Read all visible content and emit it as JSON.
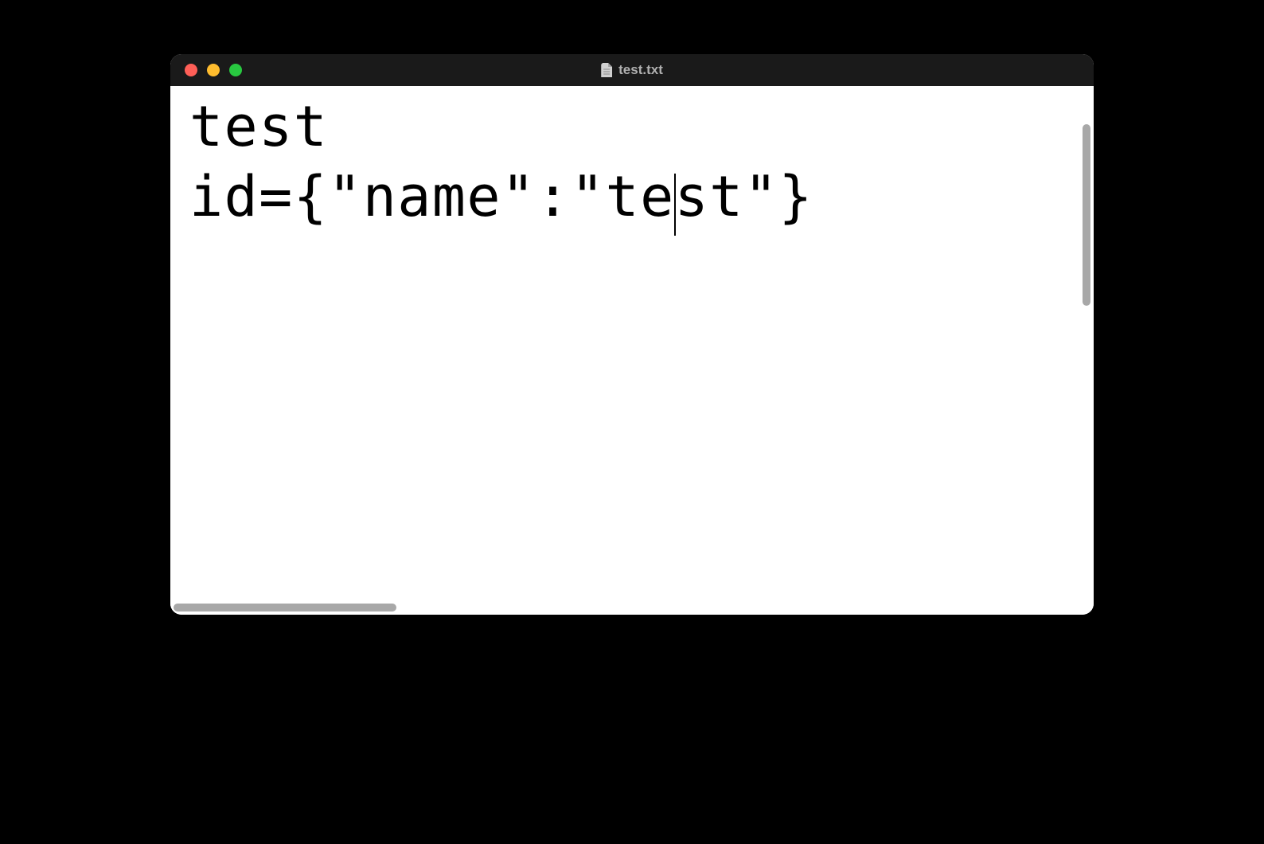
{
  "window": {
    "title": "test.txt"
  },
  "editor": {
    "lines": [
      "test",
      "id={\"name\":\"test\"}"
    ],
    "line2_before_cursor": "id={\"name\":\"te",
    "line2_after_cursor": "st\"}"
  }
}
